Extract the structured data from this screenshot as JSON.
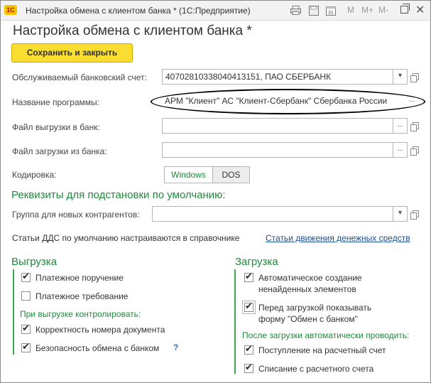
{
  "window": {
    "title": "Настройка обмена с клиентом банка * (1С:Предприятие)",
    "logo": "1С",
    "m_plus": "M+",
    "m_minus": "M-",
    "m": "M"
  },
  "form": {
    "title": "Настройка обмена с клиентом банка *",
    "save_label": "Сохранить и закрыть",
    "bank_account_label": "Обслуживаемый банковский счет:",
    "bank_account_value": "40702810338040413151, ПАО СБЕРБАНК",
    "program_label": "Название программы:",
    "program_value": "АРМ \"Клиент\" АС \"Клиент-Сбербанк\" Сбербанка России",
    "export_file_label": "Файл выгрузки в банк:",
    "export_file_value": "",
    "import_file_label": "Файл загрузки из банка:",
    "import_file_value": "",
    "encoding_label": "Кодировка:",
    "encoding_options": [
      "Windows",
      "DOS"
    ],
    "encoding_selected": "Windows",
    "defaults_title": "Реквизиты для подстановки по умолчанию:",
    "group_label": "Группа для новых контрагентов:",
    "group_value": "",
    "dds_text": "Статьи ДДС по умолчанию настраиваются в справочнике",
    "dds_link": "Статьи движения денежных средств",
    "ellipsis": "...",
    "dropdown": "▾"
  },
  "export": {
    "title": "Выгрузка",
    "items": [
      {
        "label": "Платежное поручение",
        "checked": true
      },
      {
        "label": "Платежное требование",
        "checked": false
      }
    ],
    "control_title": "При выгрузке контролировать:",
    "control_items": [
      {
        "label": "Корректность номера документа",
        "checked": true
      },
      {
        "label": "Безопасность обмена с банком",
        "checked": true
      }
    ],
    "help": "?"
  },
  "import": {
    "title": "Загрузка",
    "items": [
      {
        "label_line1": "Автоматическое создание",
        "label_line2": "ненайденных элементов",
        "checked": true
      },
      {
        "label_line1": "Перед загрузкой показывать",
        "label_line2": "форму \"Обмен с банком\"",
        "checked": true
      }
    ],
    "post_title": "После загрузки автоматически проводить:",
    "post_items": [
      {
        "label": "Поступление на расчетный счет",
        "checked": true
      },
      {
        "label": "Списание с расчетного счета",
        "checked": true
      }
    ]
  },
  "colors": {
    "accent_green": "#1e8a3c",
    "save_yellow": "#f9dd30",
    "link_blue": "#1b4f93"
  }
}
